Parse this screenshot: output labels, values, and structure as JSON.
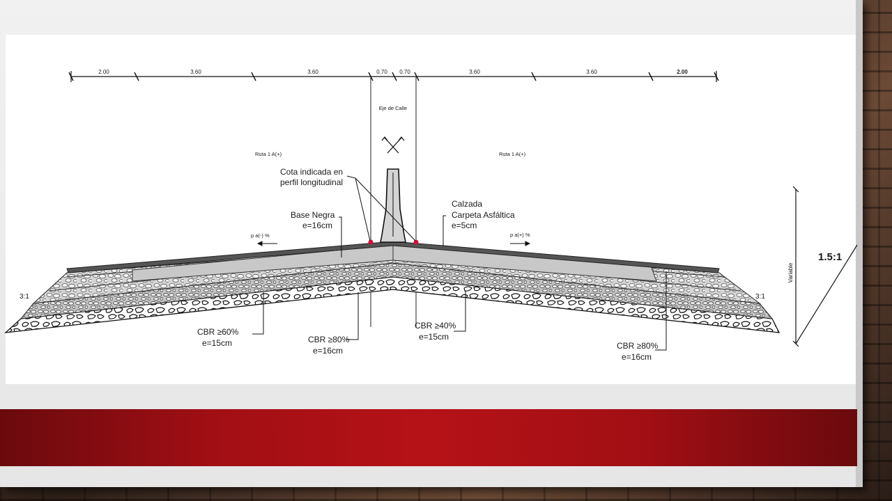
{
  "dimensions": [
    "2.00",
    "3.60",
    "3.60",
    "0.70",
    "0.70",
    "3.60",
    "3.60",
    "2.00"
  ],
  "labels": {
    "axis": "Eje de Calle",
    "route_left": "Ruta 1 A(+)",
    "route_right": "Ruta 1 A(+)",
    "cota_1": "Cota indicada en",
    "cota_2": "perfil longitudinal",
    "base_1": "Base Negra",
    "base_2": "e=16cm",
    "calzada_1": "Calzada",
    "calzada_2": "Carpeta Asfáltica",
    "calzada_3": "e=5cm",
    "slope_left": "p a(-) %",
    "slope_right": "p a(+) %",
    "ratio_left": "3:1",
    "ratio_right": "3:1",
    "variable": "Variable",
    "slope_ratio": "1.5:1",
    "cbr60_1": "CBR ≥60%",
    "cbr60_2": "e=15cm",
    "cbr80l_1": "CBR ≥80%",
    "cbr80l_2": "e=16cm",
    "cbr40_1": "CBR ≥40%",
    "cbr40_2": "e=15cm",
    "cbr80r_1": "CBR ≥80%",
    "cbr80r_2": "e=16cm"
  },
  "colors": {
    "accent_red": "#b51217",
    "marker_red": "#d0103a",
    "asphalt": "#555555",
    "base_gray": "#c8c8c8"
  }
}
